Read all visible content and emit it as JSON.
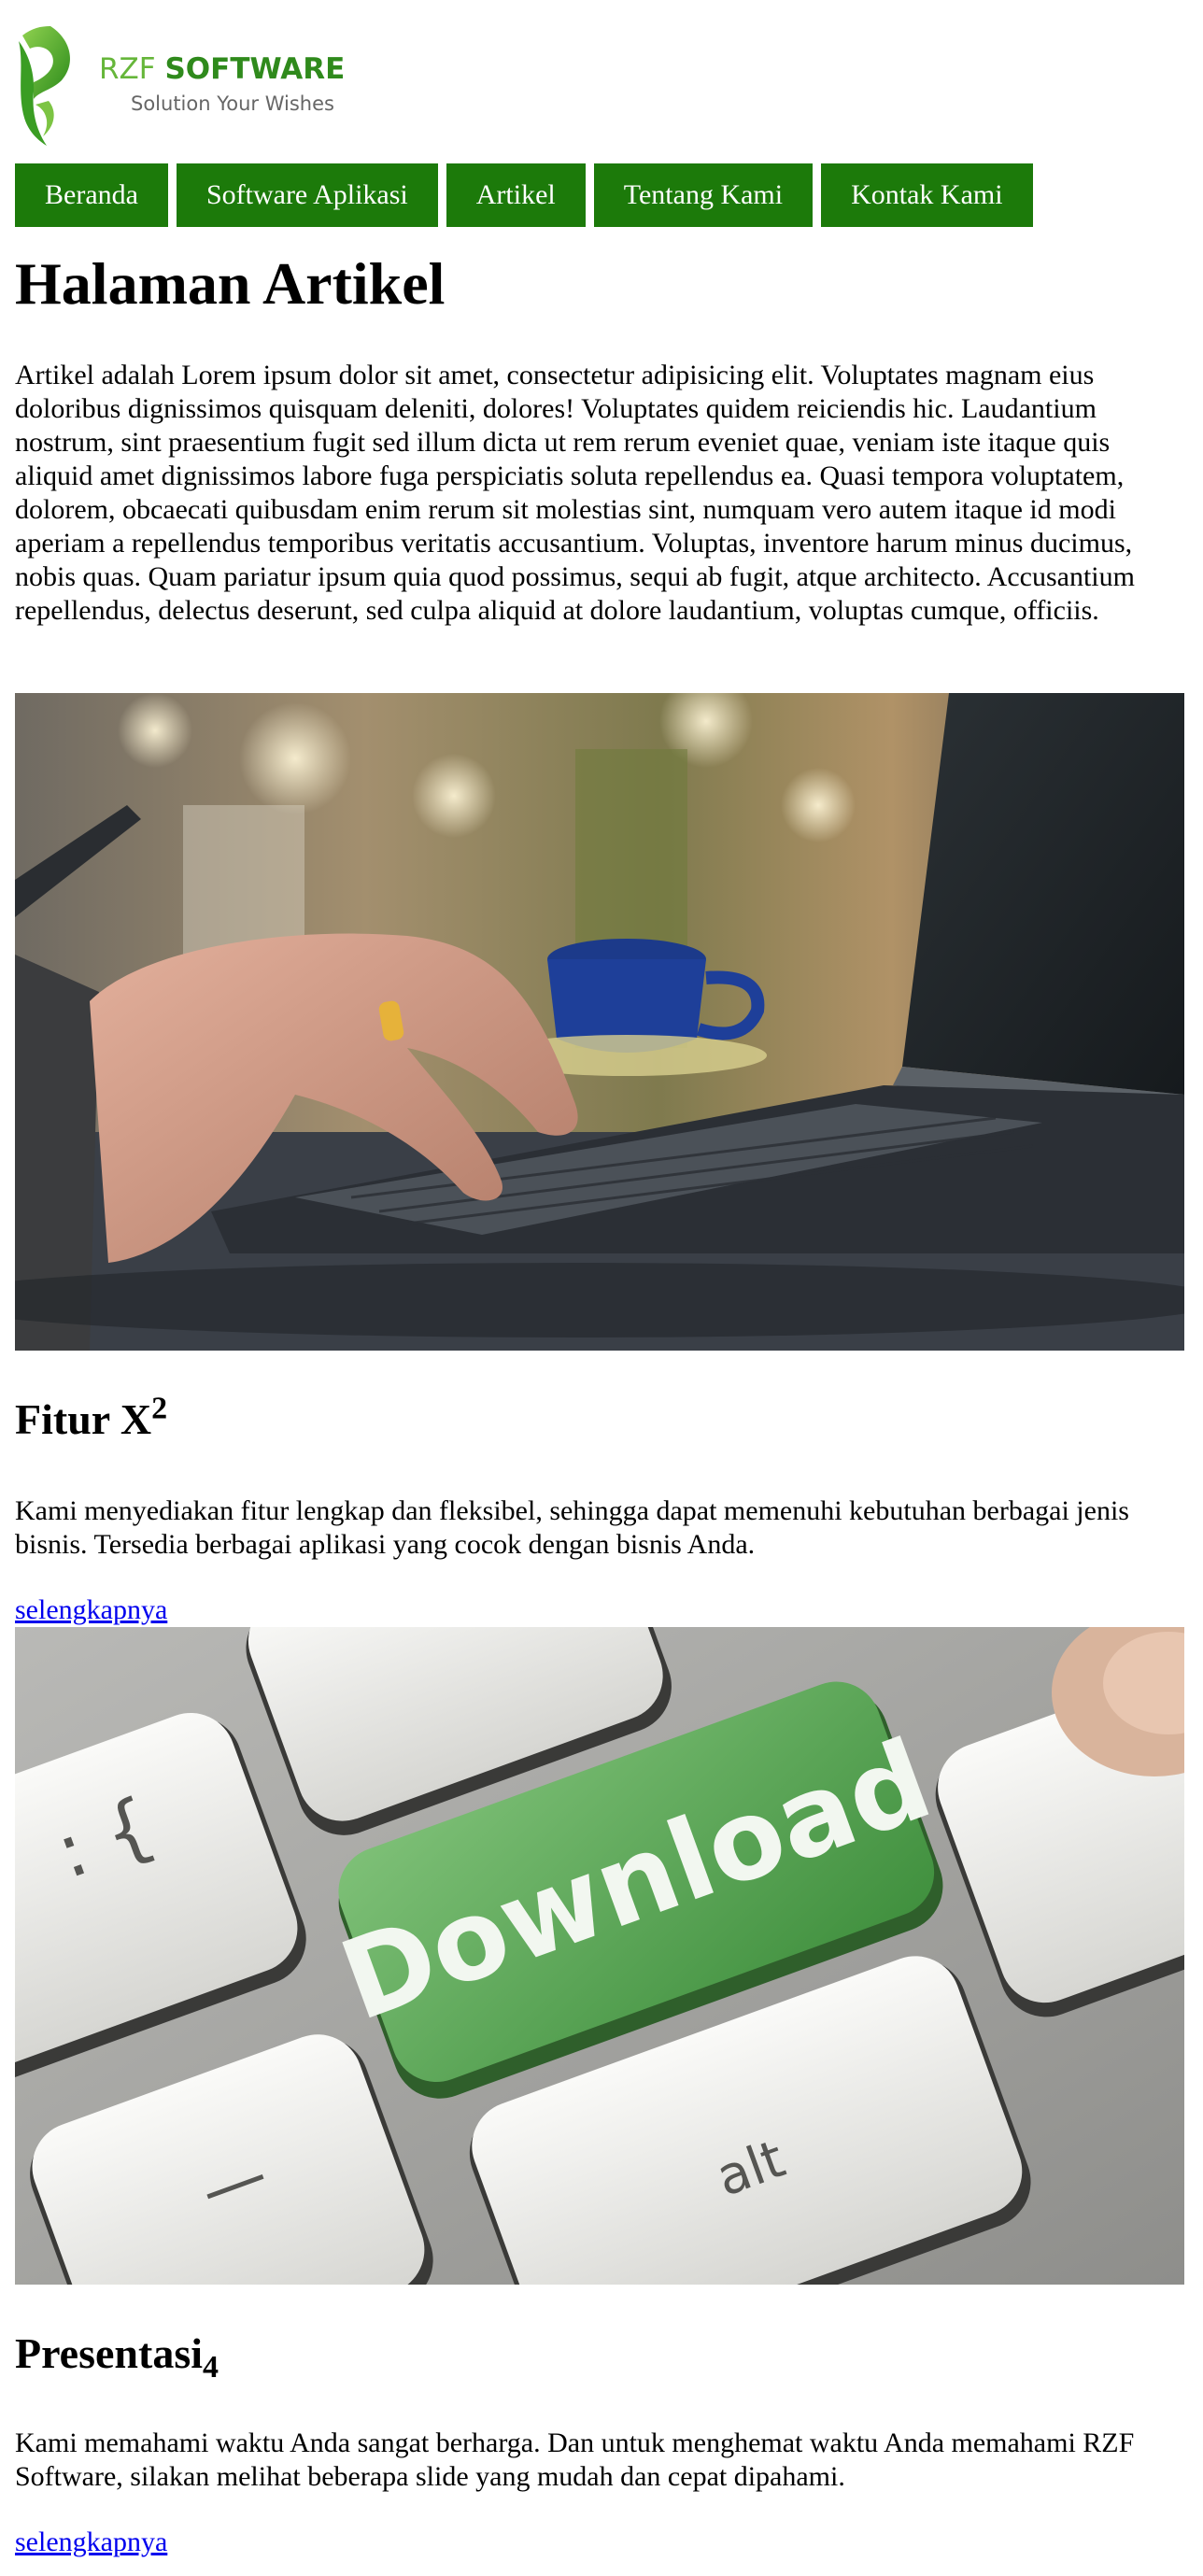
{
  "brand": {
    "name_part1": "RZF ",
    "name_part2": "SOFTWARE",
    "tagline": "Solution Your Wishes"
  },
  "nav": {
    "items": [
      {
        "label": "Beranda"
      },
      {
        "label": "Software Aplikasi"
      },
      {
        "label": "Artikel"
      },
      {
        "label": "Tentang Kami"
      },
      {
        "label": "Kontak Kami"
      }
    ]
  },
  "page": {
    "title": "Halaman Artikel",
    "intro": "Artikel adalah Lorem ipsum dolor sit amet, consectetur adipisicing elit. Voluptates magnam eius doloribus dignissimos quisquam deleniti, dolores! Voluptates quidem reiciendis hic. Laudantium nostrum, sint praesentium fugit sed illum dicta ut rem rerum eveniet quae, veniam iste itaque quis aliquid amet dignissimos labore fuga perspiciatis soluta repellendus ea. Quasi tempora voluptatem, dolorem, obcaecati quibusdam enim rerum sit molestias sint, numquam vero autem itaque id modi aperiam a repellendus temporibus veritatis accusantium. Voluptas, inventore harum minus ducimus, nobis quas. Quam pariatur ipsum quia quod possimus, sequi ab fugit, atque architecto. Accusantium repellendus, delectus deserunt, sed culpa aliquid at dolore laudantium, voluptas cumque, officiis."
  },
  "sections": [
    {
      "title": "Fitur X",
      "title_sup": "2",
      "text": "Kami menyediakan fitur lengkap dan fleksibel, sehingga dapat memenuhi kebutuhan berbagai jenis bisnis. Tersedia berbagai aplikasi yang cocok dengan bisnis Anda.",
      "link": "selengkapnya"
    },
    {
      "title": "Presentasi",
      "title_sub": "4",
      "text": "Kami memahami waktu Anda sangat berharga. Dan untuk menghemat waktu Anda memahami RZF Software, silakan melihat beberapa slide yang mudah dan cepat dipahami.",
      "link": "selengkapnya"
    }
  ],
  "images": {
    "download_key_text": "Download",
    "alt_key_text": "alt"
  },
  "colors": {
    "nav_bg": "#1c7a0a",
    "brand_light": "#66b63a",
    "brand_dark": "#2f8a1c",
    "link": "#0000ee"
  }
}
